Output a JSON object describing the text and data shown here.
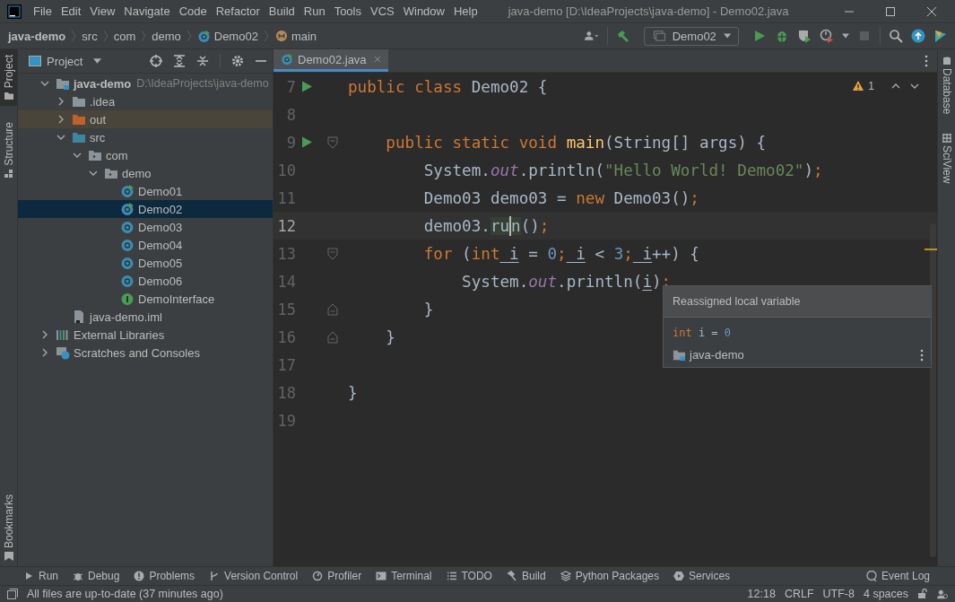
{
  "window": {
    "title": "java-demo [D:\\IdeaProjects\\java-demo] - Demo02.java"
  },
  "menu": [
    "File",
    "Edit",
    "View",
    "Navigate",
    "Code",
    "Refactor",
    "Build",
    "Run",
    "Tools",
    "VCS",
    "Window",
    "Help"
  ],
  "breadcrumbs": [
    {
      "label": "java-demo",
      "kind": "project"
    },
    {
      "label": "src",
      "kind": "folder"
    },
    {
      "label": "com",
      "kind": "folder"
    },
    {
      "label": "demo",
      "kind": "folder"
    },
    {
      "label": "Demo02",
      "kind": "class"
    },
    {
      "label": "main",
      "kind": "method"
    }
  ],
  "toolbar": {
    "run_configuration": "Demo02"
  },
  "left_stripe": [
    {
      "label": "Project",
      "selected": true,
      "kind": "project"
    },
    {
      "label": "Structure",
      "selected": false,
      "kind": "structure"
    },
    {
      "label": "Bookmarks",
      "selected": false,
      "kind": "bookmarks"
    }
  ],
  "project_panel": {
    "title": "Project",
    "tree": [
      {
        "label": "java-demo",
        "hint": "D:\\IdeaProjects\\java-demo",
        "kind": "module",
        "expanded": true,
        "selected": false,
        "children": [
          {
            "label": ".idea",
            "kind": "folder",
            "expanded": false,
            "selected": false
          },
          {
            "label": "out",
            "kind": "excluded",
            "expanded": false,
            "selected": false
          },
          {
            "label": "src",
            "kind": "source",
            "expanded": true,
            "selected": false,
            "children": [
              {
                "label": "com",
                "kind": "package",
                "expanded": true,
                "selected": false,
                "children": [
                  {
                    "label": "demo",
                    "kind": "package",
                    "expanded": true,
                    "selected": false,
                    "children": [
                      {
                        "label": "Demo01",
                        "kind": "main-class",
                        "selected": false
                      },
                      {
                        "label": "Demo02",
                        "kind": "main-class",
                        "selected": true
                      },
                      {
                        "label": "Demo03",
                        "kind": "class",
                        "selected": false
                      },
                      {
                        "label": "Demo04",
                        "kind": "class",
                        "selected": false
                      },
                      {
                        "label": "Demo05",
                        "kind": "class",
                        "selected": false
                      },
                      {
                        "label": "Demo06",
                        "kind": "class",
                        "selected": false
                      },
                      {
                        "label": "DemoInterface",
                        "kind": "interface",
                        "selected": false
                      }
                    ]
                  }
                ]
              }
            ]
          },
          {
            "label": "java-demo.iml",
            "kind": "iml",
            "selected": false
          }
        ]
      },
      {
        "label": "External Libraries",
        "kind": "libraries",
        "expanded": false,
        "selected": false
      },
      {
        "label": "Scratches and Consoles",
        "kind": "scratches",
        "expanded": false,
        "selected": false
      }
    ]
  },
  "editor": {
    "tabs": [
      {
        "label": "Demo02.java",
        "selected": true
      }
    ],
    "warnings": "1",
    "lines": [
      {
        "number": "7",
        "current": false,
        "markers": [
          {
            "kind": "run"
          }
        ],
        "tokens": [
          {
            "text": "public",
            "kind": "keyword"
          },
          {
            "text": " class",
            "kind": "keyword"
          },
          {
            "text": " Demo02 {",
            "kind": "plain"
          }
        ]
      },
      {
        "number": "8",
        "current": false
      },
      {
        "number": "9",
        "current": false,
        "markers": [
          {
            "kind": "run"
          },
          {
            "kind": "fold-start"
          }
        ],
        "tokens": [
          {
            "text": "    public static void",
            "kind": "keyword"
          },
          {
            "text": " main",
            "kind": "method"
          },
          {
            "text": "(String[] args) {",
            "kind": "plain"
          }
        ]
      },
      {
        "number": "10",
        "current": false,
        "tokens": [
          {
            "text": "        System.",
            "kind": "plain"
          },
          {
            "text": "out",
            "kind": "field"
          },
          {
            "text": ".println(",
            "kind": "plain"
          },
          {
            "text": "\"Hello World! Demo02\"",
            "kind": "string"
          },
          {
            "text": ")",
            "kind": "plain"
          },
          {
            "text": ";",
            "kind": "keyword"
          }
        ]
      },
      {
        "number": "11",
        "current": false,
        "tokens": [
          {
            "text": "        Demo03 demo03 = ",
            "kind": "plain"
          },
          {
            "text": "new",
            "kind": "keyword"
          },
          {
            "text": " Demo03()",
            "kind": "plain"
          },
          {
            "text": ";",
            "kind": "keyword"
          }
        ]
      },
      {
        "number": "12",
        "current": true,
        "tokens": [
          {
            "text": "        demo03.",
            "kind": "plain"
          },
          {
            "text": "ru",
            "kind": "usage"
          },
          {
            "kind": "caret"
          },
          {
            "text": "n",
            "kind": "usage"
          },
          {
            "text": "()",
            "kind": "plain"
          },
          {
            "text": ";",
            "kind": "keyword"
          }
        ]
      },
      {
        "number": "13",
        "current": false,
        "markers": [
          {
            "kind": "fold-start"
          }
        ],
        "tokens": [
          {
            "text": "        for",
            "kind": "keyword"
          },
          {
            "text": " (",
            "kind": "plain"
          },
          {
            "text": "int",
            "kind": "keyword"
          },
          {
            "text": " i",
            "kind": "variable"
          },
          {
            "text": " = ",
            "kind": "plain"
          },
          {
            "text": "0",
            "kind": "number"
          },
          {
            "text": ";",
            "kind": "keyword"
          },
          {
            "text": " i",
            "kind": "variable"
          },
          {
            "text": " < ",
            "kind": "plain"
          },
          {
            "text": "3",
            "kind": "number"
          },
          {
            "text": ";",
            "kind": "keyword"
          },
          {
            "text": " i",
            "kind": "variable"
          },
          {
            "text": "++) {",
            "kind": "plain"
          }
        ]
      },
      {
        "number": "14",
        "current": false,
        "tokens": [
          {
            "text": "            System.",
            "kind": "plain"
          },
          {
            "text": "out",
            "kind": "field"
          },
          {
            "text": ".println(",
            "kind": "plain"
          },
          {
            "text": "i",
            "kind": "variable"
          },
          {
            "text": ")",
            "kind": "plain"
          },
          {
            "text": ";",
            "kind": "keyword"
          }
        ]
      },
      {
        "number": "15",
        "current": false,
        "markers": [
          {
            "kind": "fold-end"
          }
        ],
        "tokens": [
          {
            "text": "        }",
            "kind": "plain"
          }
        ]
      },
      {
        "number": "16",
        "current": false,
        "markers": [
          {
            "kind": "fold-end"
          }
        ],
        "tokens": [
          {
            "text": "    }",
            "kind": "plain"
          }
        ]
      },
      {
        "number": "17",
        "current": false
      },
      {
        "number": "18",
        "current": false,
        "tokens": [
          {
            "text": "}",
            "kind": "plain"
          }
        ]
      },
      {
        "number": "19",
        "current": false
      }
    ],
    "popup": {
      "title": "Reassigned local variable",
      "code": [
        {
          "text": "int",
          "kind": "keyword"
        },
        {
          "text": " i = ",
          "kind": "plain"
        },
        {
          "text": "0",
          "kind": "number"
        }
      ],
      "module": "java-demo"
    }
  },
  "right_stripe": [
    {
      "label": "Database",
      "kind": "database"
    },
    {
      "label": "SciView",
      "kind": "sciview"
    }
  ],
  "tool_windows": [
    {
      "label": "Run",
      "kind": "run"
    },
    {
      "label": "Debug",
      "kind": "debug"
    },
    {
      "label": "Problems",
      "kind": "problems"
    },
    {
      "label": "Version Control",
      "kind": "vcs"
    },
    {
      "label": "Profiler",
      "kind": "profiler"
    },
    {
      "label": "Terminal",
      "kind": "terminal"
    },
    {
      "label": "TODO",
      "kind": "todo"
    },
    {
      "label": "Build",
      "kind": "build"
    },
    {
      "label": "Python Packages",
      "kind": "packages"
    },
    {
      "label": "Services",
      "kind": "services"
    }
  ],
  "event_log": "Event Log",
  "status_bar": {
    "message": "All files are up-to-date (37 minutes ago)",
    "position": "12:18",
    "line_separator": "CRLF",
    "encoding": "UTF-8",
    "indent": "4 spaces"
  }
}
